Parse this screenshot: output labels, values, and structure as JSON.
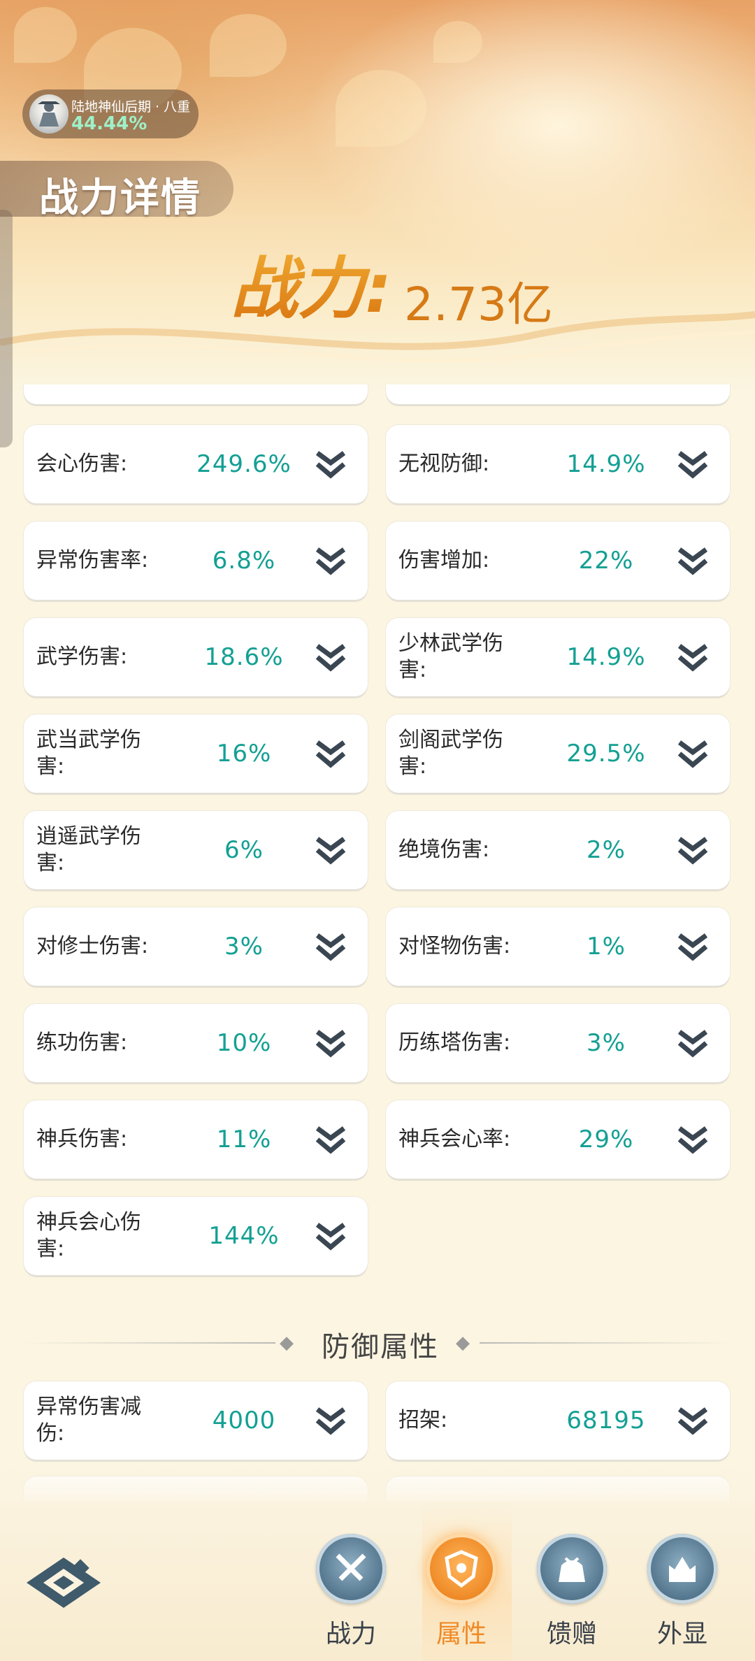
{
  "header": {
    "realm_title": "陆地神仙后期 · 八重",
    "realm_progress": "44.44%",
    "page_title": "战力详情",
    "power_label": "战力:",
    "power_value": "2.73亿"
  },
  "attack_stats": [
    {
      "label": "会心伤害:",
      "value": "249.6%"
    },
    {
      "label": "无视防御:",
      "value": "14.9%"
    },
    {
      "label": "异常伤害率:",
      "value": "6.8%"
    },
    {
      "label": "伤害增加:",
      "value": "22%"
    },
    {
      "label": "武学伤害:",
      "value": "18.6%"
    },
    {
      "label": "少林武学伤害:",
      "value": "14.9%"
    },
    {
      "label": "武当武学伤害:",
      "value": "16%"
    },
    {
      "label": "剑阁武学伤害:",
      "value": "29.5%"
    },
    {
      "label": "逍遥武学伤害:",
      "value": "6%"
    },
    {
      "label": "绝境伤害:",
      "value": "2%"
    },
    {
      "label": "对修士伤害:",
      "value": "3%"
    },
    {
      "label": "对怪物伤害:",
      "value": "1%"
    },
    {
      "label": "练功伤害:",
      "value": "10%"
    },
    {
      "label": "历练塔伤害:",
      "value": "3%"
    },
    {
      "label": "神兵伤害:",
      "value": "11%"
    },
    {
      "label": "神兵会心率:",
      "value": "29%"
    },
    {
      "label": "神兵会心伤害:",
      "value": "144%"
    }
  ],
  "defense_section": {
    "title": "防御属性",
    "stats": [
      {
        "label": "异常伤害减伤:",
        "value": "4000"
      },
      {
        "label": "招架:",
        "value": "68195"
      }
    ]
  },
  "tabs": [
    {
      "label": "战力",
      "icon": "swords-icon"
    },
    {
      "label": "属性",
      "icon": "shield-icon",
      "active": true
    },
    {
      "label": "馈赠",
      "icon": "gift-bag-icon"
    },
    {
      "label": "外显",
      "icon": "castle-icon"
    }
  ],
  "colors": {
    "value_teal": "#13a093",
    "power_orange": "#e08a1c",
    "active_tab": "#f08a25"
  }
}
